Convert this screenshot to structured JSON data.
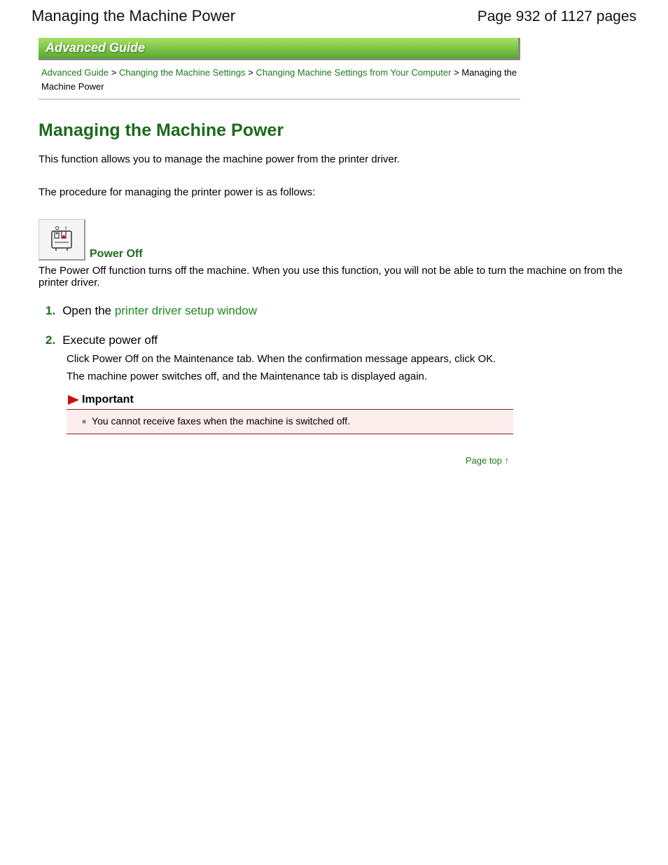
{
  "header": {
    "title_left": "Managing the Machine Power",
    "page_indicator": "Page 932 of 1127 pages"
  },
  "banner": {
    "text": "Advanced Guide"
  },
  "breadcrumb": {
    "link1": "Advanced Guide",
    "sep": " > ",
    "link2": "Changing the Machine Settings",
    "link3": "Changing Machine Settings from Your Computer",
    "current": "Managing the Machine Power"
  },
  "main": {
    "heading": "Managing the Machine Power",
    "intro1": "This function allows you to manage the machine power from the printer driver.",
    "intro2": "The procedure for managing the printer power is as follows:"
  },
  "power_off": {
    "label": "Power Off",
    "icon_name": "power-off-printer-icon",
    "desc": "The Power Off function turns off the machine. When you use this function, you will not be able to turn the machine on from the printer driver."
  },
  "steps": [
    {
      "num": "1.",
      "title_prefix": "Open the ",
      "title_link": "printer driver setup window",
      "body": []
    },
    {
      "num": "2.",
      "title_prefix": "Execute power off",
      "title_link": "",
      "body": [
        "Click Power Off on the Maintenance tab. When the confirmation message appears, click OK.",
        "The machine power switches off, and the Maintenance tab is displayed again."
      ]
    }
  ],
  "important": {
    "label": "Important",
    "items": [
      "You cannot receive faxes when the machine is switched off."
    ]
  },
  "page_top": {
    "label": "Page top",
    "arrow": "↑"
  }
}
